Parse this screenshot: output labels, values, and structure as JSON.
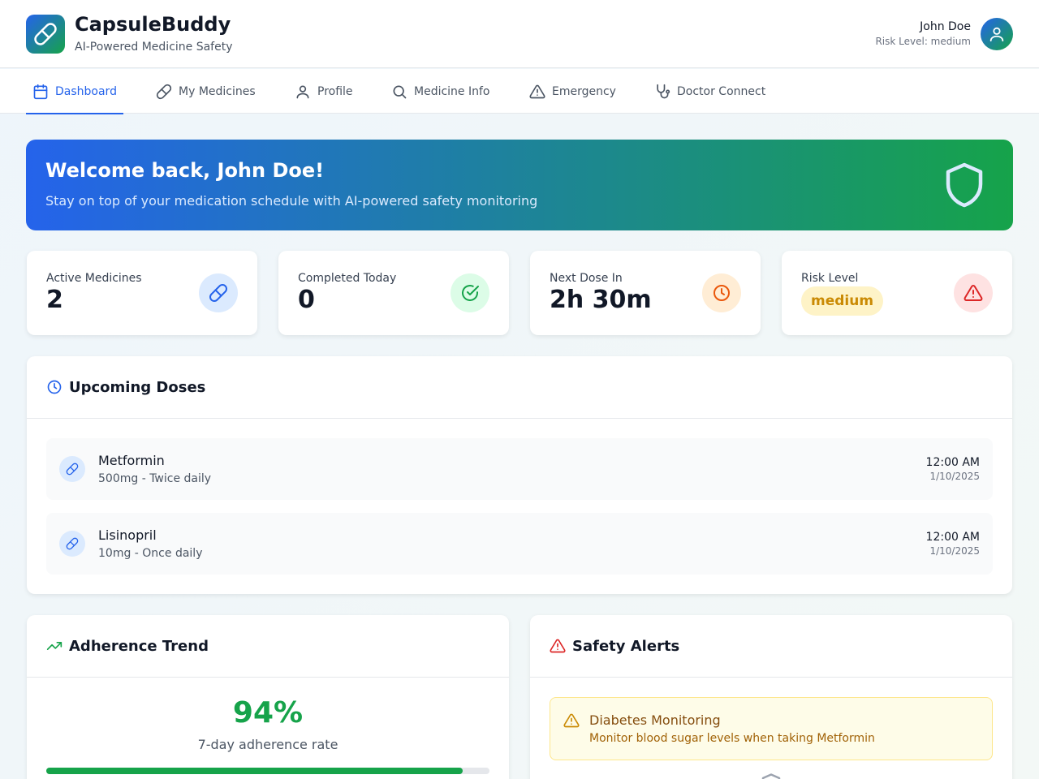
{
  "app": {
    "name": "CapsuleBuddy",
    "tagline": "AI-Powered Medicine Safety",
    "logo_icon": "pill-icon"
  },
  "user": {
    "name": "John Doe",
    "risk_text": "Risk Level: medium",
    "avatar_icon": "user-icon"
  },
  "nav": {
    "tabs": [
      {
        "label": "Dashboard",
        "icon": "calendar-icon",
        "active": true
      },
      {
        "label": "My Medicines",
        "icon": "pill-icon",
        "active": false
      },
      {
        "label": "Profile",
        "icon": "user-icon",
        "active": false
      },
      {
        "label": "Medicine Info",
        "icon": "search-icon",
        "active": false
      },
      {
        "label": "Emergency",
        "icon": "warning-icon",
        "active": false
      },
      {
        "label": "Doctor Connect",
        "icon": "stethoscope-icon",
        "active": false
      }
    ]
  },
  "welcome": {
    "title": "Welcome back, John Doe!",
    "subtitle": "Stay on top of your medication schedule with AI-powered safety monitoring",
    "icon": "shield-icon"
  },
  "stats": [
    {
      "label": "Active Medicines",
      "value": "2",
      "icon": "pill-icon",
      "color": "#2563eb"
    },
    {
      "label": "Completed Today",
      "value": "0",
      "icon": "check-circle-icon",
      "color": "#16a34a"
    },
    {
      "label": "Next Dose In",
      "value": "2h 30m",
      "icon": "clock-icon",
      "color": "#ea580c"
    },
    {
      "label": "Risk Level",
      "value": "medium",
      "icon": "warning-icon",
      "color": "#dc2626"
    }
  ],
  "upcoming": {
    "title": "Upcoming Doses",
    "items": [
      {
        "name": "Metformin",
        "detail": "500mg - Twice daily",
        "time": "12:00 AM",
        "date": "1/10/2025"
      },
      {
        "name": "Lisinopril",
        "detail": "10mg - Once daily",
        "time": "12:00 AM",
        "date": "1/10/2025"
      }
    ]
  },
  "adherence": {
    "title": "Adherence Trend",
    "value": "94%",
    "label": "7-day adherence rate",
    "progress": 0.94
  },
  "alerts": {
    "title": "Safety Alerts",
    "items": [
      {
        "title": "Diabetes Monitoring",
        "message": "Monitor blood sugar levels when taking Metformin"
      }
    ]
  },
  "colors": {
    "primary": "#2563eb",
    "success": "#16a34a",
    "warning": "#ca8a04",
    "danger": "#dc2626"
  }
}
